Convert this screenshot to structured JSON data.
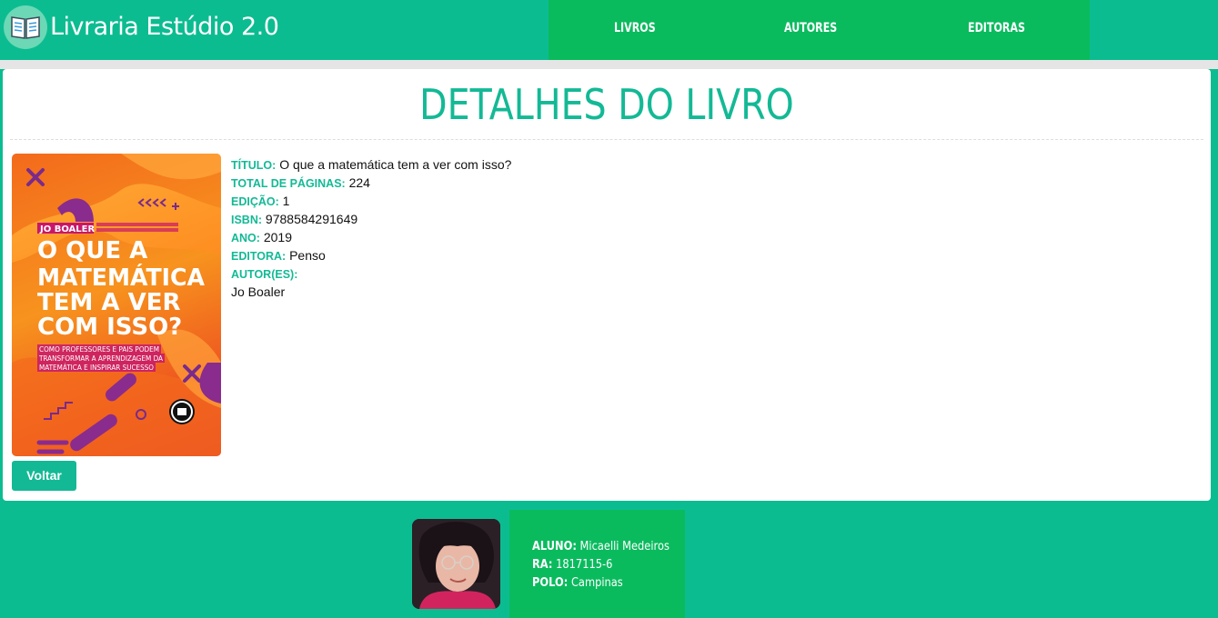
{
  "app": {
    "title": "Livraria Estúdio 2.0",
    "logo_icon": "book-icon"
  },
  "nav": {
    "items": [
      {
        "label": "LIVROS"
      },
      {
        "label": "AUTORES"
      },
      {
        "label": "EDITORAS"
      }
    ]
  },
  "page": {
    "title": "DETALHES DO LIVRO"
  },
  "book": {
    "cover": {
      "author": "JO BOALER",
      "title_lines": [
        "O QUE A",
        "MATEMÁTICA",
        "TEM A VER",
        "COM ISSO?"
      ],
      "subtitle_lines": [
        "COMO PROFESSORES E PAIS PODEM",
        "TRANSFORMAR A APRENDIZAGEM DA",
        "MATEMÁTICA E INSPIRAR SUCESSO"
      ]
    },
    "fields": [
      {
        "label": "TÍTULO:",
        "value": "O que a matemática tem a ver com isso?"
      },
      {
        "label": "TOTAL DE PÁGINAS:",
        "value": "224"
      },
      {
        "label": "EDIÇÃO:",
        "value": "1"
      },
      {
        "label": "ISBN:",
        "value": "9788584291649"
      },
      {
        "label": "ANO:",
        "value": "2019"
      },
      {
        "label": "EDITORA:",
        "value": "Penso"
      },
      {
        "label": "AUTOR(ES):",
        "value": ""
      }
    ],
    "authors": [
      "Jo Boaler"
    ]
  },
  "actions": {
    "back_label": "Voltar"
  },
  "student": {
    "aluno_label": "ALUNO:",
    "aluno_value": "Micaelli Medeiros",
    "ra_label": "RA:",
    "ra_value": "1817115-6",
    "polo_label": "POLO:",
    "polo_value": "Campinas"
  },
  "colors": {
    "accent": "#13b995",
    "header_bg": "#0cbc91",
    "nav_bg": "#0abb5e",
    "card_bg": "#ffffff"
  }
}
